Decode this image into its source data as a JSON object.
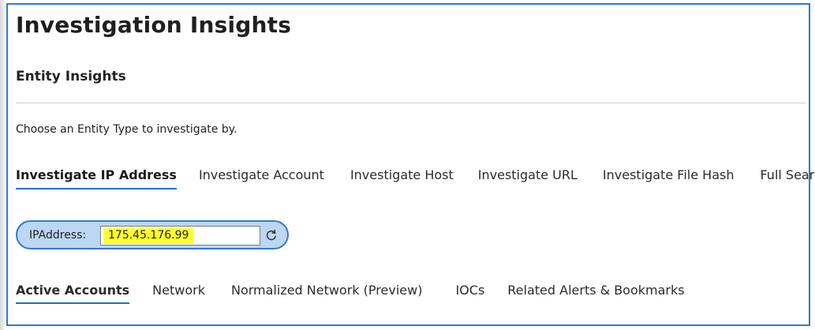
{
  "page": {
    "title": "Investigation Insights",
    "section_title": "Entity Insights",
    "prompt": "Choose an Entity Type to investigate by."
  },
  "entity_tabs": [
    {
      "label": "Investigate IP Address",
      "active": true
    },
    {
      "label": "Investigate Account",
      "active": false
    },
    {
      "label": "Investigate Host",
      "active": false
    },
    {
      "label": "Investigate URL",
      "active": false
    },
    {
      "label": "Investigate File Hash",
      "active": false
    },
    {
      "label": "Full Search",
      "active": false
    }
  ],
  "parameter": {
    "label": "IPAddress:",
    "value": "175.45.176.99"
  },
  "result_tabs": [
    {
      "label": "Active Accounts",
      "active": true
    },
    {
      "label": "Network",
      "active": false
    },
    {
      "label": "Normalized Network (Preview)",
      "active": false
    },
    {
      "label": "IOCs",
      "active": false
    },
    {
      "label": "Related Alerts & Bookmarks",
      "active": false
    }
  ],
  "icons": {
    "refresh": "refresh-icon"
  },
  "colors": {
    "accent": "#1f6fd1",
    "frame_border": "#2f78d6",
    "parameter_fill": "#bcd6f3",
    "highlight": "#ffff33"
  }
}
